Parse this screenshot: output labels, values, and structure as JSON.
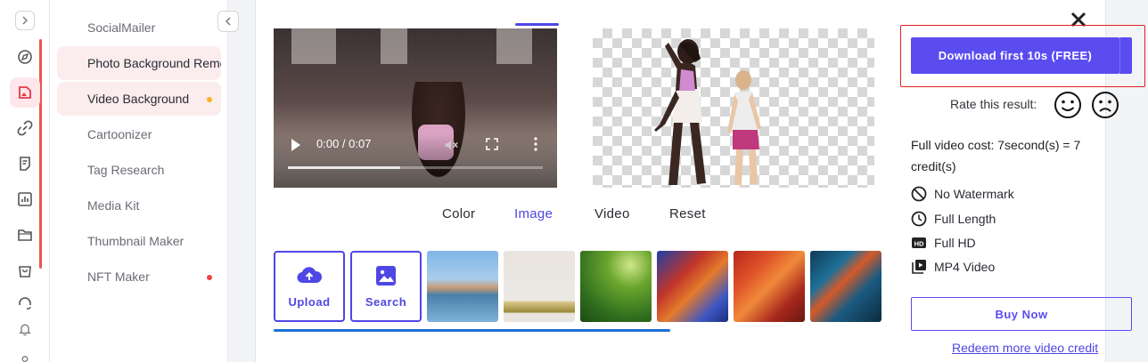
{
  "rail": {
    "accent_color": "#ef5350",
    "icons": [
      "expand-icon",
      "explore-icon",
      "photo-tools-icon",
      "link-icon",
      "document-icon",
      "analytics-icon",
      "folder-icon",
      "shopping-bag-icon",
      "support-icon",
      "bell-icon"
    ]
  },
  "sidebar": {
    "items": [
      {
        "label": "SocialMailer",
        "highlighted": false,
        "dot": ""
      },
      {
        "label": "Photo Background Remover",
        "highlighted": true,
        "dot": ""
      },
      {
        "label": "Video Background",
        "highlighted": true,
        "dot": "#f5b323"
      },
      {
        "label": "Cartoonizer",
        "highlighted": false,
        "dot": ""
      },
      {
        "label": "Tag Research",
        "highlighted": false,
        "dot": ""
      },
      {
        "label": "Media Kit",
        "highlighted": false,
        "dot": ""
      },
      {
        "label": "Thumbnail Maker",
        "highlighted": false,
        "dot": ""
      },
      {
        "label": "NFT Maker",
        "highlighted": false,
        "dot": "#ef4444"
      }
    ]
  },
  "video": {
    "time": "0:00 / 0:07",
    "progress": 0.44
  },
  "tabs": {
    "items": [
      "Color",
      "Image",
      "Video",
      "Reset"
    ],
    "active": "Image"
  },
  "background_options": {
    "upload_label": "Upload",
    "search_label": "Search"
  },
  "result": {
    "download_label": "Download first 10s (FREE)",
    "rate_label": "Rate this result:",
    "cost_text": "Full video cost: 7second(s) = 7 credit(s)",
    "features": [
      {
        "icon": "no-watermark-icon",
        "label": "No Watermark"
      },
      {
        "icon": "clock-icon",
        "label": "Full Length"
      },
      {
        "icon": "hd-icon",
        "label": "Full HD"
      },
      {
        "icon": "video-file-icon",
        "label": "MP4 Video"
      }
    ],
    "buy_label": "Buy Now",
    "redeem_label": "Redeem more video credit"
  },
  "colors": {
    "brand": "#5b4cf0",
    "active_tab": "#4f46e5",
    "highlight_frame": "#e02020",
    "scroll_indicator": "#1d6fd6"
  }
}
